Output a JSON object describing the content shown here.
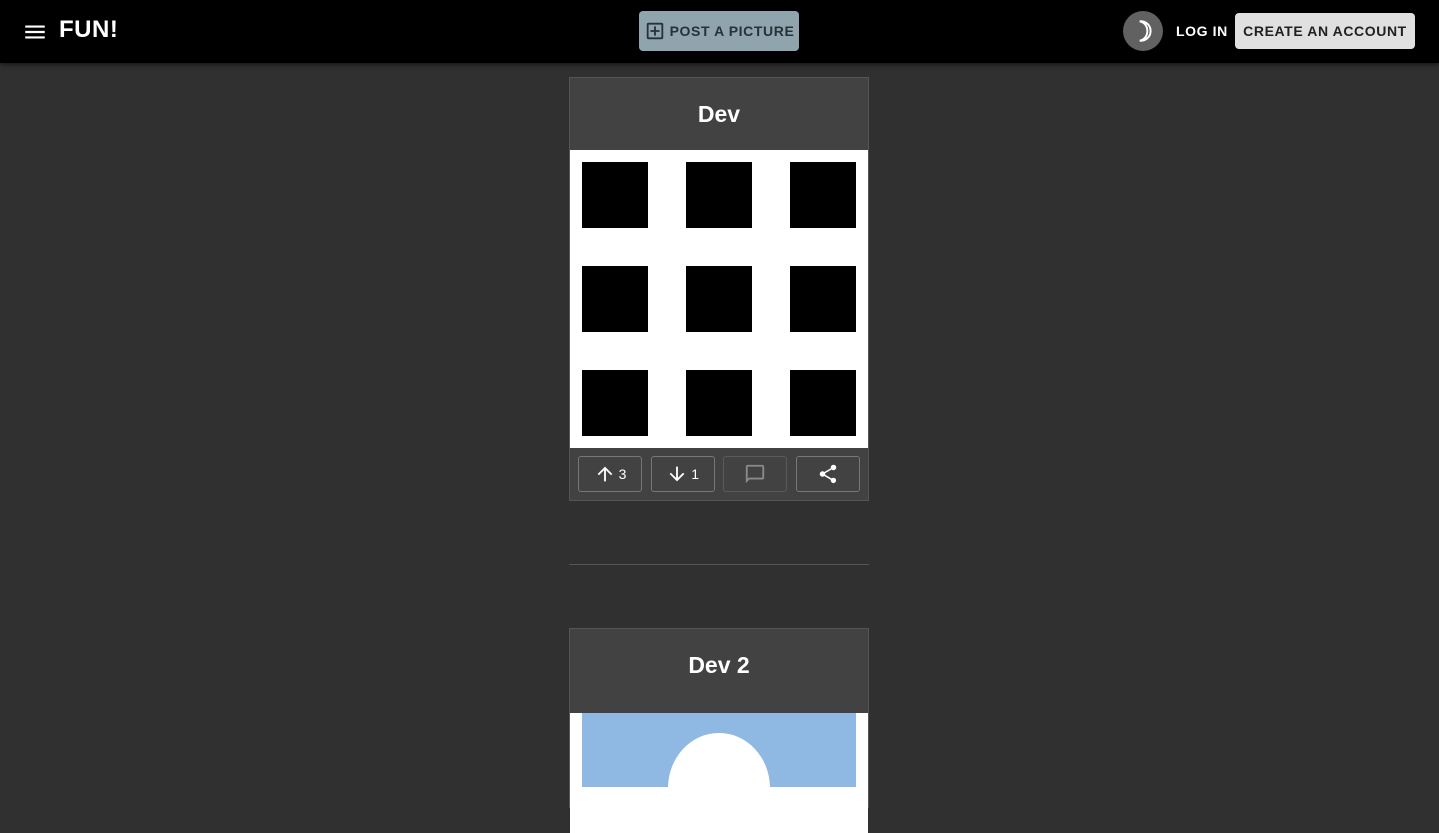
{
  "appbar": {
    "menu_icon": "menu-icon",
    "brand": "FUN!",
    "post_button_label": "POST A PICTURE",
    "post_button_icon": "add-box-icon",
    "theme_icon": "dark-mode-moon-icon",
    "login_label": "LOG IN",
    "signup_label": "CREATE AN ACCOUNT"
  },
  "posts": [
    {
      "title": "Dev",
      "image": "black-squares-grid",
      "upvotes": "3",
      "downvotes": "1",
      "icons": {
        "up": "arrow-upward-icon",
        "down": "arrow-downward-icon",
        "comment": "comment-icon",
        "share": "share-icon"
      }
    },
    {
      "title": "Dev 2",
      "image": "avatar-silhouette"
    }
  ],
  "colors": {
    "background": "#303030",
    "appbar": "#000000",
    "card": "#424242",
    "post_button": "#90a4ae",
    "signup_button": "#e0e0e0",
    "photo_bg": "#8fb8e2"
  }
}
